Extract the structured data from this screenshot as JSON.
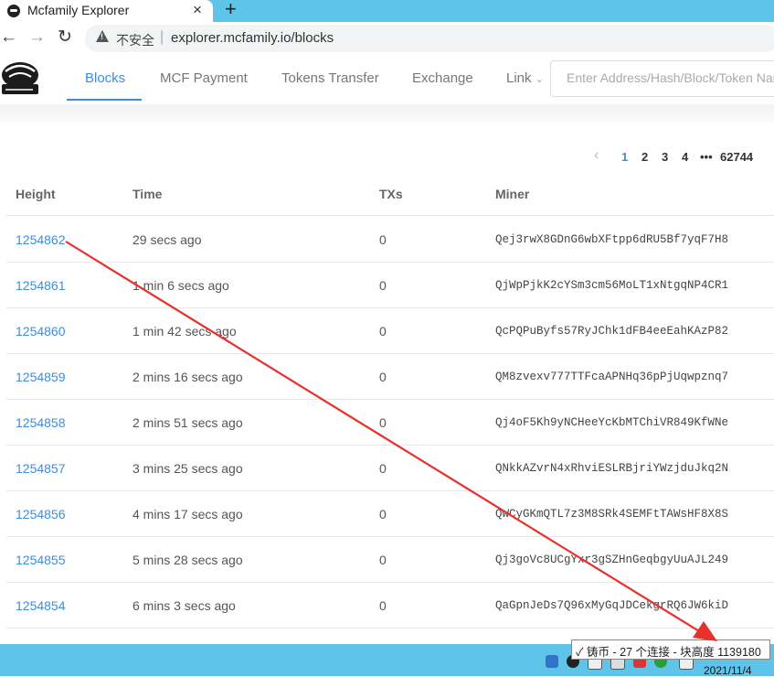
{
  "browser": {
    "tab_title": "Mcfamily Explorer",
    "close_symbol": "×",
    "new_tab_symbol": "+",
    "insecure_label": "不安全",
    "url": "explorer.mcfamily.io/blocks"
  },
  "nav": {
    "items": [
      "Blocks",
      "MCF Payment",
      "Tokens Transfer",
      "Exchange",
      "Link"
    ],
    "active": "Blocks",
    "search_placeholder": "Enter Address/Hash/Block/Token Name"
  },
  "pagination": {
    "pages": [
      "1",
      "2",
      "3",
      "4",
      "•••",
      "62744"
    ],
    "current": "1"
  },
  "table": {
    "headers": [
      "Height",
      "Time",
      "TXs",
      "Miner"
    ],
    "rows": [
      {
        "height": "1254862",
        "time": "29 secs ago",
        "txs": "0",
        "miner": "Qej3rwX8GDnG6wbXFtpp6dRU5Bf7yqF7H8"
      },
      {
        "height": "1254861",
        "time": "1 min 6 secs ago",
        "txs": "0",
        "miner": "QjWpPjkK2cYSm3cm56MoLT1xNtgqNP4CR1"
      },
      {
        "height": "1254860",
        "time": "1 min 42 secs ago",
        "txs": "0",
        "miner": "QcPQPuByfs57RyJChk1dFB4eeEahKAzP82"
      },
      {
        "height": "1254859",
        "time": "2 mins 16 secs ago",
        "txs": "0",
        "miner": "QM8zvexv777TTFcaAPNHq36pPjUqwpznq7"
      },
      {
        "height": "1254858",
        "time": "2 mins 51 secs ago",
        "txs": "0",
        "miner": "Qj4oF5Kh9yNCHeeYcKbMTChiVR849KfWNe"
      },
      {
        "height": "1254857",
        "time": "3 mins 25 secs ago",
        "txs": "0",
        "miner": "QNkkAZvrN4xRhviESLRBjriYWzjduJkq2N"
      },
      {
        "height": "1254856",
        "time": "4 mins 17 secs ago",
        "txs": "0",
        "miner": "QWCyGKmQTL7z3M8SRk4SEMFtTAWsHF8X8S"
      },
      {
        "height": "1254855",
        "time": "5 mins 28 secs ago",
        "txs": "0",
        "miner": "Qj3goVc8UCgYxr3gSZHnGeqbgyUuAJL249"
      },
      {
        "height": "1254854",
        "time": "6 mins 3 secs ago",
        "txs": "0",
        "miner": "QaGpnJeDs7Q96xMyGqJDCekgrRQ6JW6kiD"
      }
    ]
  },
  "taskbar": {
    "tooltip": "✓ 铸币 - 27 个连接 - 块高度 1139180",
    "clock_date": "2021/11/4"
  },
  "colors": {
    "accent": "#3c8dde",
    "taskbar": "#5ec4ea",
    "annotation_arrow": "#e8312a"
  }
}
